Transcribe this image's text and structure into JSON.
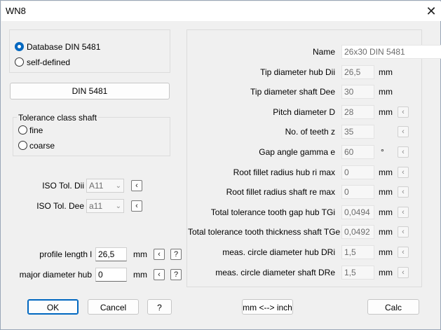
{
  "window": {
    "title": "WN8",
    "close_glyph": "✕"
  },
  "source": {
    "options": [
      {
        "label": "Database DIN 5481",
        "selected": true
      },
      {
        "label": "self-defined",
        "selected": false
      }
    ],
    "standard_button": "DIN 5481"
  },
  "tolerance_class": {
    "title": "Tolerance class shaft",
    "options": [
      {
        "label": "fine",
        "selected": false
      },
      {
        "label": "coarse",
        "selected": false
      }
    ]
  },
  "iso": {
    "dii_label": "ISO Tol. Dii",
    "dii_value": "A11",
    "dee_label": "ISO Tol. Dee",
    "dee_value": "a11",
    "arrow_glyph": "‹"
  },
  "profile": {
    "length_label": "profile length l",
    "length_value": "26,5",
    "length_unit": "mm",
    "major_label": "major diameter hub",
    "major_value": "0",
    "major_unit": "mm",
    "help_glyph": "?",
    "arrow_glyph": "‹"
  },
  "params": [
    {
      "label": "Name",
      "value": "26x30   DIN 5481",
      "unit": "",
      "arrow": false
    },
    {
      "label": "Tip diameter hub Dii",
      "value": "26,5",
      "unit": "mm",
      "arrow": false
    },
    {
      "label": "Tip diameter shaft Dee",
      "value": "30",
      "unit": "mm",
      "arrow": false
    },
    {
      "label": "Pitch diameter D",
      "value": "28",
      "unit": "mm",
      "arrow": true
    },
    {
      "label": "No. of teeth z",
      "value": "35",
      "unit": "",
      "arrow": true
    },
    {
      "label": "Gap angle gamma e",
      "value": "60",
      "unit": "°",
      "arrow": true
    },
    {
      "label": "Root fillet radius hub ri max",
      "value": "0",
      "unit": "mm",
      "arrow": true
    },
    {
      "label": "Root fillet radius shaft re max",
      "value": "0",
      "unit": "mm",
      "arrow": true
    },
    {
      "label": "Total tolerance tooth gap hub TGi",
      "value": "0,0494",
      "unit": "mm",
      "arrow": true
    },
    {
      "label": "Total tolerance tooth thickness shaft TGe",
      "value": "0,0492",
      "unit": "mm",
      "arrow": true
    },
    {
      "label": "meas. circle diameter hub DRi",
      "value": "1,5",
      "unit": "mm",
      "arrow": true
    },
    {
      "label": "meas. circle diameter shaft DRe",
      "value": "1,5",
      "unit": "mm",
      "arrow": true
    }
  ],
  "param_arrow_glyph": "‹",
  "footer": {
    "ok": "OK",
    "cancel": "Cancel",
    "help": "?",
    "units": "mm <--> inch",
    "calc": "Calc"
  }
}
